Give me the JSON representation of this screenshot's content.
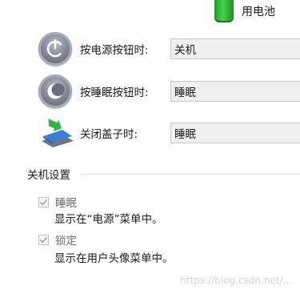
{
  "header": {
    "battery_label": "用电池"
  },
  "rows": [
    {
      "label": "按电源按钮时:",
      "value": "关机"
    },
    {
      "label": "按睡眠按钮时:",
      "value": "睡眠"
    },
    {
      "label": "关闭盖子时:",
      "value": "睡眠"
    }
  ],
  "shutdown_settings": {
    "title": "关机设置",
    "items": [
      {
        "label": "睡眠",
        "checked": true,
        "description": "显示在“电源”菜单中。"
      },
      {
        "label": "锁定",
        "checked": true,
        "description": "显示在用户头像菜单中。"
      }
    ]
  },
  "watermark": "https://blog.csdn.net/..."
}
